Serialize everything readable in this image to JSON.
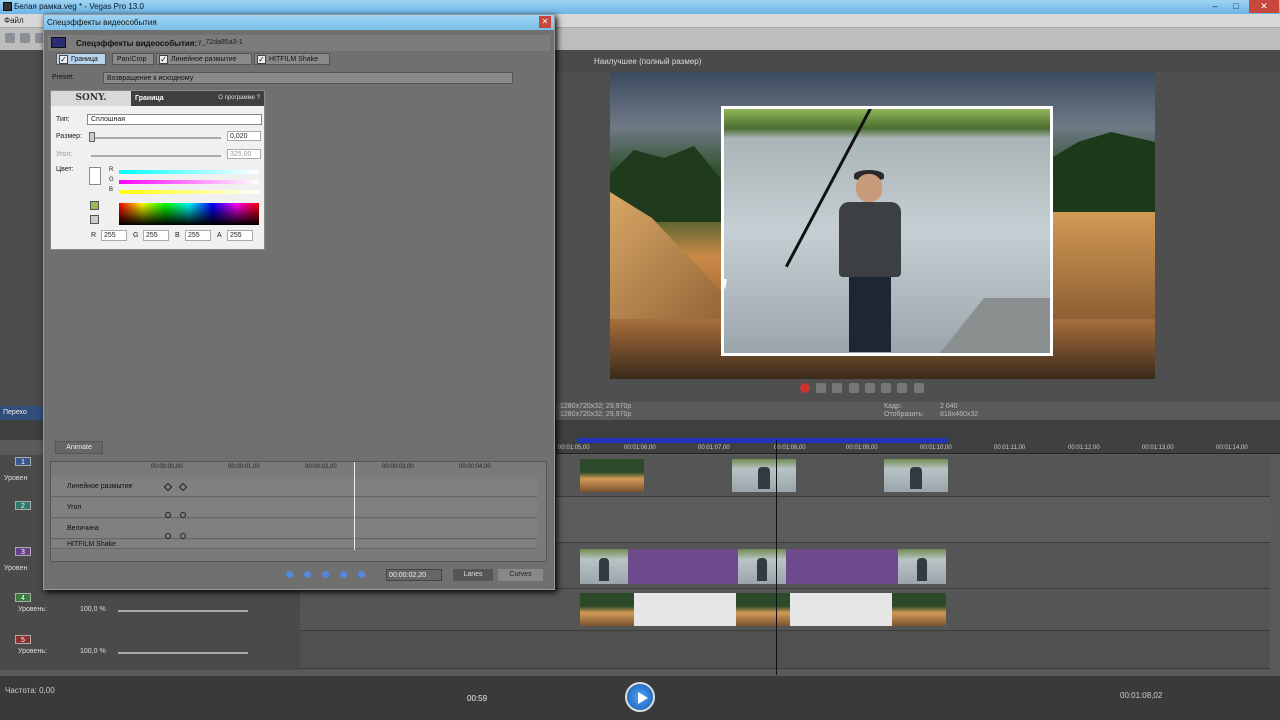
{
  "window": {
    "title": "Белая рамка.veg * - Vegas Pro 13.0",
    "menu_first": "Файл"
  },
  "preview": {
    "quality": "Наилучшее (полный размер)",
    "proj_info": "1280x720x32; 29,970p",
    "proj_info2": "1280x720x32; 29,970p",
    "frame_label": "Кадр:",
    "frame_value": "2 040",
    "display_label": "Отобразить:",
    "display_value": "818x460x32"
  },
  "left_panel": {
    "tab": "Перехо"
  },
  "ruler": [
    "00:01:05,00",
    "00:01:06,00",
    "00:01:07,00",
    "00:01:08,00",
    "00:01:09,00",
    "00:01:10,00",
    "00:01:11,00",
    "00:01:12,00",
    "00:01:13,00",
    "00:01:14,00"
  ],
  "tracks": [
    {
      "num": "1",
      "label": "Уровен"
    },
    {
      "num": "2",
      "label": ""
    },
    {
      "num": "3",
      "label": "Уровен"
    },
    {
      "num": "4",
      "label": "Уровень:",
      "pct": "100,0 %"
    },
    {
      "num": "5",
      "label": "Уровень:",
      "pct": "100,0 %"
    }
  ],
  "bottom": {
    "rate": "Частота: 0,00",
    "time": "00:59",
    "timecode": "00:01:08,02"
  },
  "dialog": {
    "title": "Спецэффекты видеособытия",
    "header_name": "Спецэффекты видеособытия:",
    "header_id": "y_72da85a3-1",
    "chain": [
      "Граница",
      "Pan/Crop",
      "Линейное размытие",
      "HITFILM Shake"
    ],
    "preset_label": "Preset:",
    "preset_value": "Возвращение к исходному",
    "fx": {
      "brand": "SONY.",
      "name": "Граница",
      "about": "О программе",
      "about_q": "?",
      "type_label": "Тип:",
      "type_value": "Сплошная",
      "size_label": "Размер:",
      "size_value": "0,020",
      "angle_label": "Угол:",
      "angle_value": "325,00",
      "color_label": "Цвет:",
      "ch_r": "R",
      "ch_g": "G",
      "ch_b": "B",
      "r_label": "R",
      "r": "255",
      "g_label": "G",
      "g": "255",
      "b_label": "B",
      "b": "255",
      "a_label": "A",
      "a": "255"
    },
    "animate": "Animate",
    "kf_ruler": [
      "00:00:00,00",
      "00:00:01,00",
      "00:00:02,00",
      "00:00:03,00",
      "00:00:04,00"
    ],
    "kf_rows": [
      "Линейное размытие",
      "Угол",
      "Величина",
      "HITFILM Shake"
    ],
    "time": "00:00:02,20",
    "lanes": "Lanes",
    "curves": "Curves"
  }
}
